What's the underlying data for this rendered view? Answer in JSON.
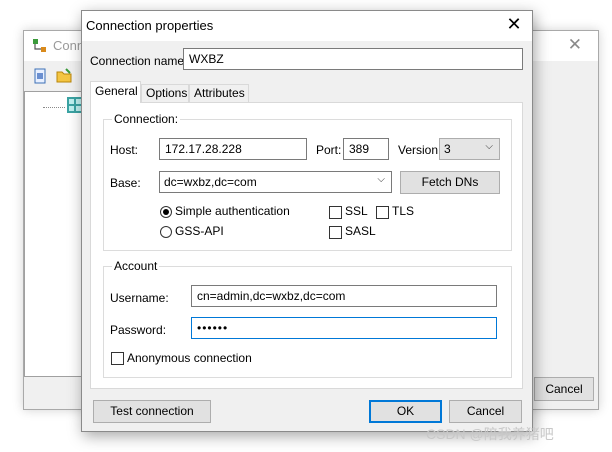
{
  "background_window": {
    "title": "Conn",
    "cancel_label": "Cancel"
  },
  "dialog": {
    "title": "Connection properties",
    "close_glyph": "✕",
    "connection_name_label": "Connection name:",
    "connection_name_value": "WXBZ",
    "tabs": [
      "General",
      "Options",
      "Attributes"
    ],
    "active_tab": "General",
    "connection_group": {
      "title": "Connection:",
      "host_label": "Host:",
      "host_value": "172.17.28.228",
      "port_label": "Port:",
      "port_value": "389",
      "version_label": "Version:",
      "version_value": "3",
      "base_label": "Base:",
      "base_value": "dc=wxbz,dc=com",
      "fetch_dns_label": "Fetch DNs",
      "simple_auth_label": "Simple authentication",
      "simple_auth_selected": true,
      "gss_api_label": "GSS-API",
      "ssl_label": "SSL",
      "tls_label": "TLS",
      "sasl_label": "SASL"
    },
    "account_group": {
      "title": "Account",
      "username_label": "Username:",
      "username_value": "cn=admin,dc=wxbz,dc=com",
      "password_label": "Password:",
      "password_value": "••••••",
      "anonymous_label": "Anonymous connection"
    },
    "buttons": {
      "test_connection": "Test connection",
      "ok": "OK",
      "cancel": "Cancel"
    }
  },
  "watermark": "CSDN @陪我养猪吧",
  "icons": [
    "app-icon",
    "close-icon",
    "new-connection-icon",
    "open-folder-icon",
    "directory-node-icon",
    "dropdown-arrow-icon"
  ]
}
